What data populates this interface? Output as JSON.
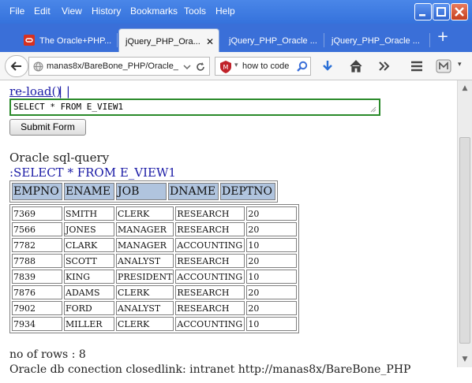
{
  "menubar": {
    "items": [
      "File",
      "Edit",
      "View",
      "History",
      "Bookmarks",
      "Tools",
      "Help"
    ]
  },
  "tabs": [
    {
      "label": "The Oracle+PHP...",
      "icon": "oracle-icon"
    },
    {
      "label": "jQuery_PHP_Ora...",
      "icon": "none"
    },
    {
      "label": "jQuery_PHP_Oracle ...",
      "icon": "none"
    },
    {
      "label": "jQuery_PHP_Oracle ...",
      "icon": "none"
    }
  ],
  "navbar": {
    "url": "manas8x/BareBone_PHP/Oracle_",
    "search": "how to code"
  },
  "page": {
    "reload_link": "re-load()",
    "reload_sep": "| |",
    "sql_value": "SELECT * FROM E_VIEW1",
    "submit_label": "Submit Form",
    "heading": "Oracle sql-query",
    "query_echo": ":SELECT * FROM E_VIEW1",
    "columns": [
      "EMPNO",
      "ENAME",
      "JOB",
      "DNAME",
      "DEPTNO"
    ],
    "rows": [
      [
        "7369",
        "SMITH",
        "CLERK",
        "RESEARCH",
        "20"
      ],
      [
        "7566",
        "JONES",
        "MANAGER",
        "RESEARCH",
        "20"
      ],
      [
        "7782",
        "CLARK",
        "MANAGER",
        "ACCOUNTING",
        "10"
      ],
      [
        "7788",
        "SCOTT",
        "ANALYST",
        "RESEARCH",
        "20"
      ],
      [
        "7839",
        "KING",
        "PRESIDENT",
        "ACCOUNTING",
        "10"
      ],
      [
        "7876",
        "ADAMS",
        "CLERK",
        "RESEARCH",
        "20"
      ],
      [
        "7902",
        "FORD",
        "ANALYST",
        "RESEARCH",
        "20"
      ],
      [
        "7934",
        "MILLER",
        "CLERK",
        "ACCOUNTING",
        "10"
      ]
    ],
    "row_count": "no of rows : 8",
    "status": "Oracle db conection closedlink: intranet http://manas8x/BareBone_PHP"
  },
  "colors": {
    "link": "#1a1aa6",
    "header_bg": "#b0c4de",
    "chrome": "#3a6fd8",
    "input_border": "#2a8a2a"
  }
}
